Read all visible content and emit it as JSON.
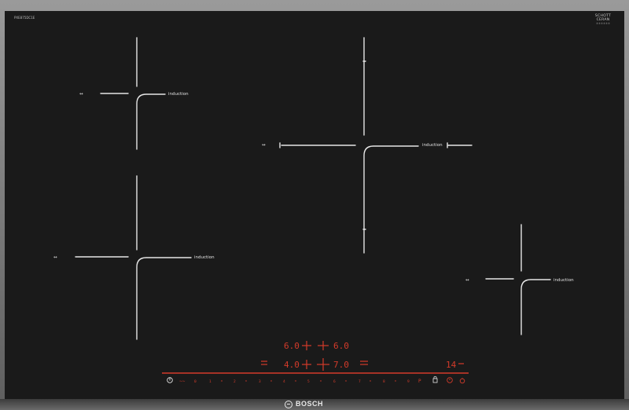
{
  "appliance": {
    "model_code": "PXE875DC1E",
    "glass_brand": [
      "SCHOTT",
      "CERAN",
      "®®®®®®"
    ],
    "manufacturer": "BOSCH"
  },
  "zones": [
    {
      "id": "front-left-zone",
      "combine_label": "↔",
      "type_label": "induction"
    },
    {
      "id": "rear-left-zone",
      "combine_label": "↔",
      "type_label": "induction"
    },
    {
      "id": "center-zone",
      "combine_label": "↔",
      "type_label": "induction"
    },
    {
      "id": "right-zone",
      "combine_label": "↔",
      "type_label": "induction"
    }
  ],
  "display": {
    "rear_left_power": "6.0",
    "rear_right_power": "6.0",
    "front_left_power": "4.0",
    "front_right_power": "7.0",
    "timer_value": "14"
  },
  "control_bar": {
    "power_icon": "power-icon",
    "scale": [
      "0",
      "1",
      "2",
      "3",
      "4",
      "5",
      "6",
      "7",
      "8",
      "9"
    ],
    "boost_label": "P",
    "timer_icon": "timer-icon",
    "lock_icon": "lock-icon",
    "wipe_icon": "wipe-protection-icon"
  },
  "colors": {
    "glass": "#1a1a1a",
    "lines": "#e6e6e6",
    "control_red": "#d43b2a"
  }
}
